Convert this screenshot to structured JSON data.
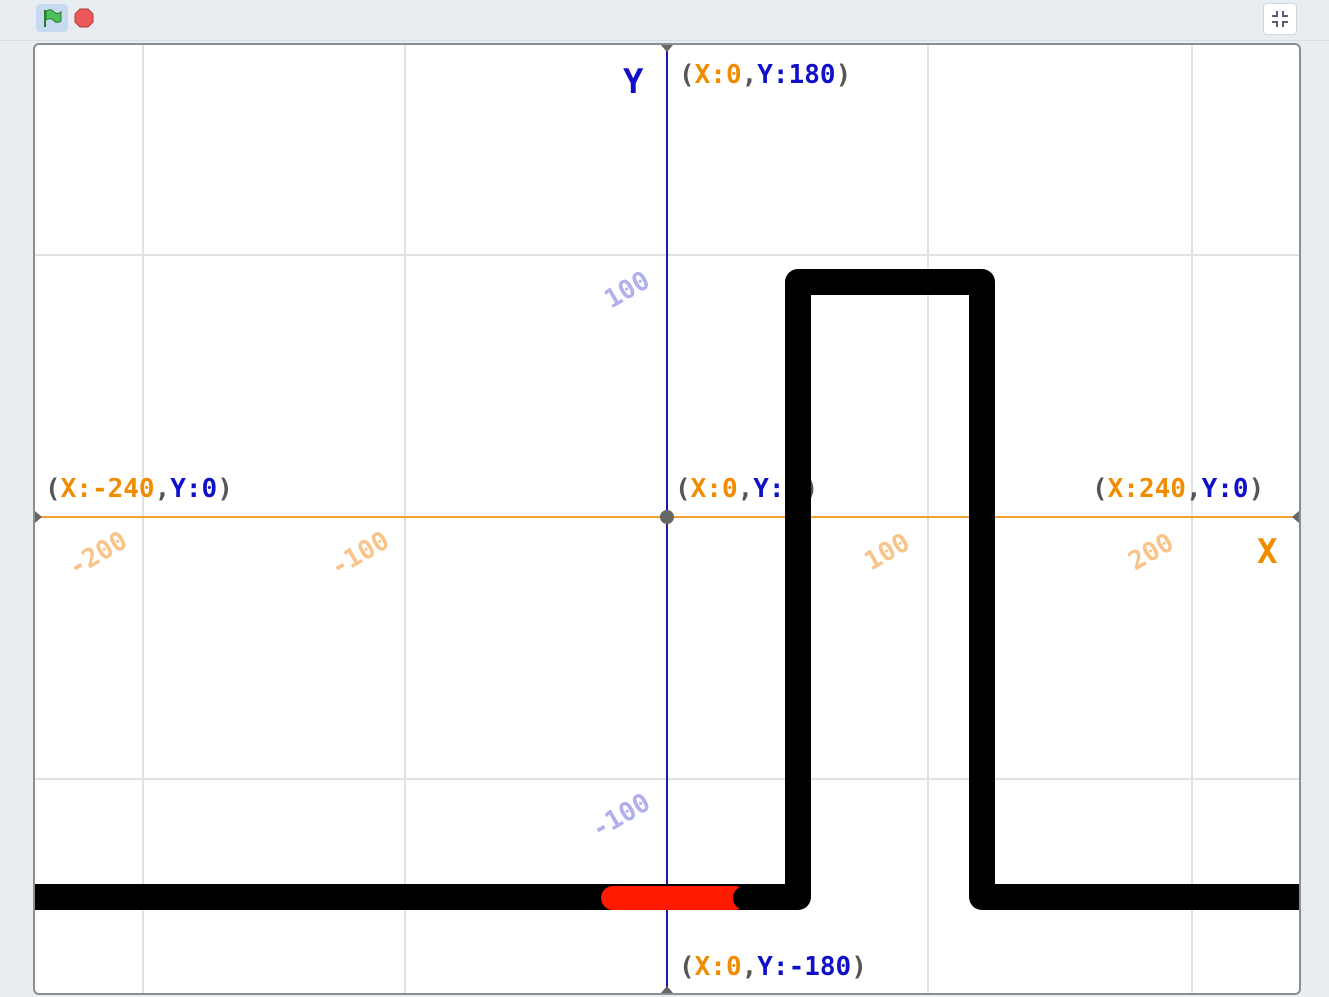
{
  "toolbar": {
    "green_flag_icon": "green-flag-icon",
    "stop_icon": "stop-sign-icon",
    "fullscreen_icon": "exit-fullscreen-icon"
  },
  "stage": {
    "y_axis_letter": "Y",
    "x_axis_letter": "X",
    "top_label": {
      "open": "(",
      "x": "X:0",
      "comma": ",",
      "y": "Y:180",
      "close": ")"
    },
    "bottom_label": {
      "open": "(",
      "x": "X:0",
      "comma": ",",
      "y": "Y:-180",
      "close": ")"
    },
    "left_label": {
      "open": "(",
      "x": "X:-240",
      "comma": ",",
      "y": "Y:0",
      "close": ")"
    },
    "right_label": {
      "open": "(",
      "x": "X:240",
      "comma": ",",
      "y": "Y:0",
      "close": ")"
    },
    "center_label": {
      "open": "(",
      "x": "X:0",
      "comma": ",",
      "y": "Y:",
      "close": ")"
    },
    "x_ticks": [
      "-200",
      "-100",
      "100",
      "200"
    ],
    "y_ticks": [
      "100",
      "-100"
    ],
    "colors": {
      "x_axis": "#f0a030",
      "y_axis": "#1a1aa8",
      "label_x": "#f08c00",
      "label_y": "#1010c8",
      "paren": "#555555",
      "grid": "#e2e2e2",
      "pen": "#000000",
      "sprite": "#ff1a00"
    }
  }
}
